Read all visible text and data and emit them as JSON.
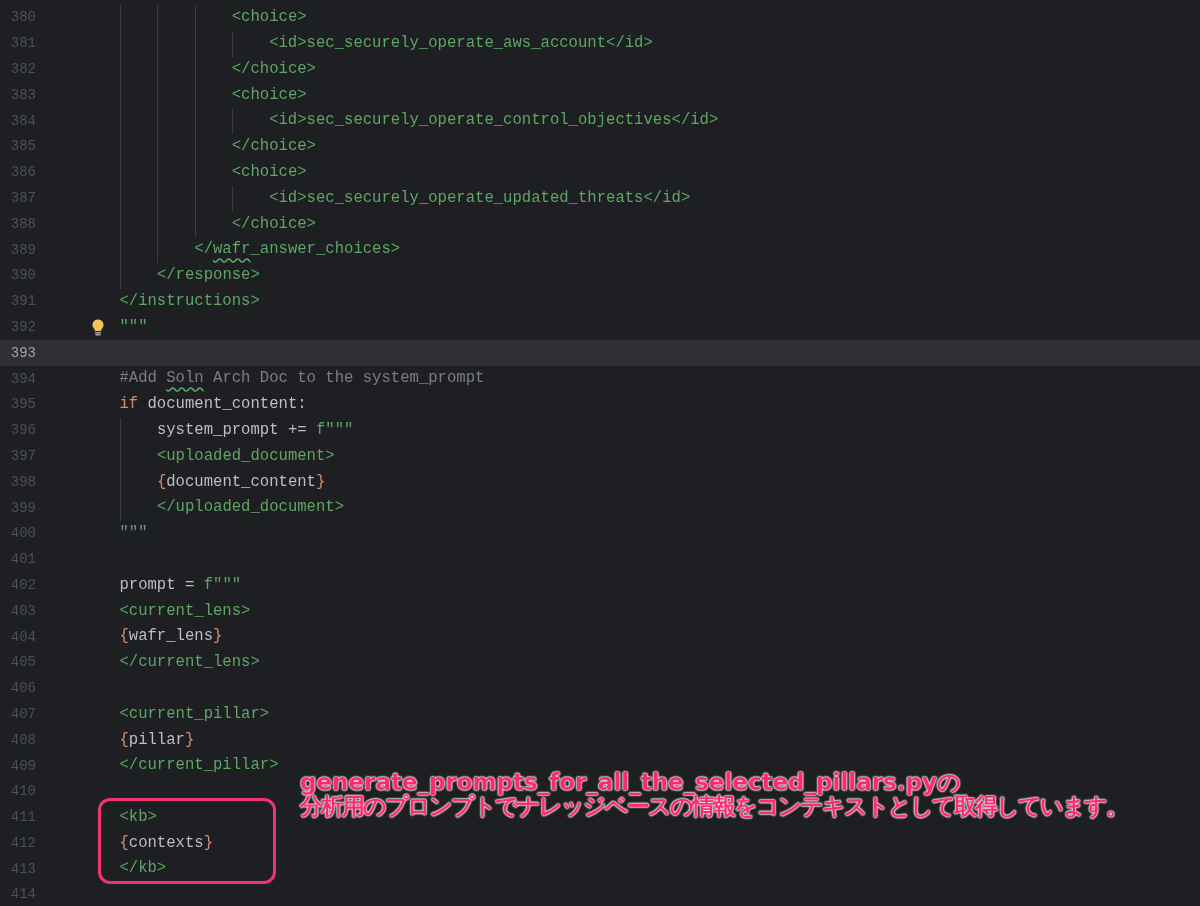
{
  "editor": {
    "lines": [
      {
        "number": "380",
        "current": false,
        "hint": false,
        "tokens": [
          {
            "kind": "tag",
            "text": "                <choice>"
          }
        ]
      },
      {
        "number": "381",
        "current": false,
        "hint": false,
        "tokens": [
          {
            "kind": "tag",
            "text": "                    <id>sec_securely_operate_aws_account</id>"
          }
        ]
      },
      {
        "number": "382",
        "current": false,
        "hint": false,
        "tokens": [
          {
            "kind": "tag",
            "text": "                </choice>"
          }
        ]
      },
      {
        "number": "383",
        "current": false,
        "hint": false,
        "tokens": [
          {
            "kind": "tag",
            "text": "                <choice>"
          }
        ]
      },
      {
        "number": "384",
        "current": false,
        "hint": false,
        "tokens": [
          {
            "kind": "tag",
            "text": "                    <id>sec_securely_operate_control_objectives</id>"
          }
        ]
      },
      {
        "number": "385",
        "current": false,
        "hint": false,
        "tokens": [
          {
            "kind": "tag",
            "text": "                </choice>"
          }
        ]
      },
      {
        "number": "386",
        "current": false,
        "hint": false,
        "tokens": [
          {
            "kind": "tag",
            "text": "                <choice>"
          }
        ]
      },
      {
        "number": "387",
        "current": false,
        "hint": false,
        "tokens": [
          {
            "kind": "tag",
            "text": "                    <id>sec_securely_operate_updated_threats</id>"
          }
        ]
      },
      {
        "number": "388",
        "current": false,
        "hint": false,
        "tokens": [
          {
            "kind": "tag",
            "text": "                </choice>"
          }
        ]
      },
      {
        "number": "389",
        "current": false,
        "hint": false,
        "tokens": [
          {
            "kind": "tag",
            "text": "            </"
          },
          {
            "kind": "tagtypo",
            "text": "wafr"
          },
          {
            "kind": "tag",
            "text": "_answer_choices>"
          }
        ]
      },
      {
        "number": "390",
        "current": false,
        "hint": false,
        "tokens": [
          {
            "kind": "tag",
            "text": "        </response>"
          }
        ]
      },
      {
        "number": "391",
        "current": false,
        "hint": false,
        "tokens": [
          {
            "kind": "tag",
            "text": "    </instructions>"
          }
        ]
      },
      {
        "number": "392",
        "current": false,
        "hint": true,
        "tokens": [
          {
            "kind": "string",
            "text": "    \"\"\""
          }
        ]
      },
      {
        "number": "393",
        "current": true,
        "hint": false
      },
      {
        "number": "394",
        "current": false,
        "hint": false,
        "tokens": [
          {
            "kind": "comment",
            "text": "    #Add "
          },
          {
            "kind": "commenttypo",
            "text": "Soln"
          },
          {
            "kind": "comment",
            "text": " Arch Doc to the system_prompt"
          }
        ]
      },
      {
        "number": "395",
        "current": false,
        "hint": false,
        "tokens": [
          {
            "kind": "keyword",
            "text": "    if"
          },
          {
            "kind": "plain",
            "text": " document_content:"
          }
        ]
      },
      {
        "number": "396",
        "current": false,
        "hint": false,
        "tokens": [
          {
            "kind": "plain",
            "text": "        system_prompt += "
          },
          {
            "kind": "string",
            "text": "f\"\"\""
          }
        ]
      },
      {
        "number": "397",
        "current": false,
        "hint": false,
        "tokens": [
          {
            "kind": "string",
            "text": "        <uploaded_document>"
          }
        ]
      },
      {
        "number": "398",
        "current": false,
        "hint": false,
        "tokens": [
          {
            "kind": "brace",
            "text": "        {"
          },
          {
            "kind": "plain",
            "text": "document_content"
          },
          {
            "kind": "brace",
            "text": "}"
          }
        ]
      },
      {
        "number": "399",
        "current": false,
        "hint": false,
        "tokens": [
          {
            "kind": "string",
            "text": "        </uploaded_document>"
          }
        ]
      },
      {
        "number": "400",
        "current": false,
        "hint": false,
        "tokens": [
          {
            "kind": "string",
            "text": "    \"\"\""
          }
        ]
      },
      {
        "number": "401",
        "current": false,
        "hint": false
      },
      {
        "number": "402",
        "current": false,
        "hint": false,
        "tokens": [
          {
            "kind": "plain",
            "text": "    prompt = "
          },
          {
            "kind": "string",
            "text": "f\"\"\""
          }
        ]
      },
      {
        "number": "403",
        "current": false,
        "hint": false,
        "tokens": [
          {
            "kind": "string",
            "text": "    <current_lens>"
          }
        ]
      },
      {
        "number": "404",
        "current": false,
        "hint": false,
        "tokens": [
          {
            "kind": "brace",
            "text": "    {"
          },
          {
            "kind": "plain",
            "text": "wafr_lens"
          },
          {
            "kind": "brace",
            "text": "}"
          }
        ]
      },
      {
        "number": "405",
        "current": false,
        "hint": false,
        "tokens": [
          {
            "kind": "string",
            "text": "    </current_lens>"
          }
        ]
      },
      {
        "number": "406",
        "current": false,
        "hint": false
      },
      {
        "number": "407",
        "current": false,
        "hint": false,
        "tokens": [
          {
            "kind": "string",
            "text": "    <current_pillar>"
          }
        ]
      },
      {
        "number": "408",
        "current": false,
        "hint": false,
        "tokens": [
          {
            "kind": "brace",
            "text": "    {"
          },
          {
            "kind": "plain",
            "text": "pillar"
          },
          {
            "kind": "brace",
            "text": "}"
          }
        ]
      },
      {
        "number": "409",
        "current": false,
        "hint": false,
        "tokens": [
          {
            "kind": "string",
            "text": "    </current_pillar>"
          }
        ]
      },
      {
        "number": "410",
        "current": false,
        "hint": false
      },
      {
        "number": "411",
        "current": false,
        "hint": false,
        "tokens": [
          {
            "kind": "string",
            "text": "    <kb>"
          }
        ]
      },
      {
        "number": "412",
        "current": false,
        "hint": false,
        "tokens": [
          {
            "kind": "brace",
            "text": "    {"
          },
          {
            "kind": "plain",
            "text": "contexts"
          },
          {
            "kind": "brace",
            "text": "}"
          }
        ]
      },
      {
        "number": "413",
        "current": false,
        "hint": false,
        "tokens": [
          {
            "kind": "string",
            "text": "    </kb>"
          }
        ]
      },
      {
        "number": "414",
        "current": false,
        "hint": false
      }
    ]
  },
  "annotation": {
    "lines": [
      "generate_prompts_for_all_the_selected_pillars.pyの",
      "分析用のプロンプトでナレッジベースの情報をコンテキストとして取得しています。"
    ]
  }
}
